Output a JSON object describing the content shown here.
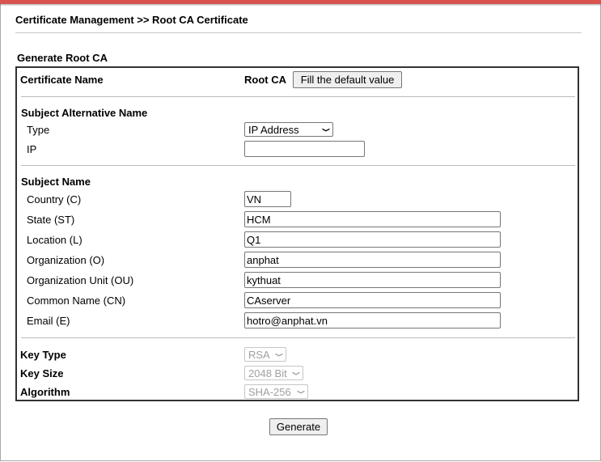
{
  "header": {
    "title": "Certificate Management >> Root CA Certificate"
  },
  "section": {
    "title": "Generate Root CA"
  },
  "cert_name": {
    "label": "Certificate Name",
    "value": "Root CA",
    "fill_button": "Fill the default value"
  },
  "san": {
    "title": "Subject Alternative Name",
    "type_label": "Type",
    "type_value": "IP Address",
    "ip_label": "IP",
    "ip_value": ""
  },
  "subject": {
    "title": "Subject Name",
    "fields": [
      {
        "label": "Country (C)",
        "value": "VN"
      },
      {
        "label": "State (ST)",
        "value": "HCM"
      },
      {
        "label": "Location (L)",
        "value": "Q1"
      },
      {
        "label": "Organization (O)",
        "value": "anphat"
      },
      {
        "label": "Organization Unit (OU)",
        "value": "kythuat"
      },
      {
        "label": "Common Name (CN)",
        "value": "CAserver"
      },
      {
        "label": "Email (E)",
        "value": "hotro@anphat.vn"
      }
    ]
  },
  "key": {
    "type_label": "Key Type",
    "type_value": "RSA",
    "size_label": "Key Size",
    "size_value": "2048 Bit",
    "algo_label": "Algorithm",
    "algo_value": "SHA-256"
  },
  "actions": {
    "generate": "Generate"
  },
  "icons": {
    "dropdown": "chevron-down-icon"
  },
  "colors": {
    "accent_bar": "#d9534f",
    "border": "#333333"
  }
}
